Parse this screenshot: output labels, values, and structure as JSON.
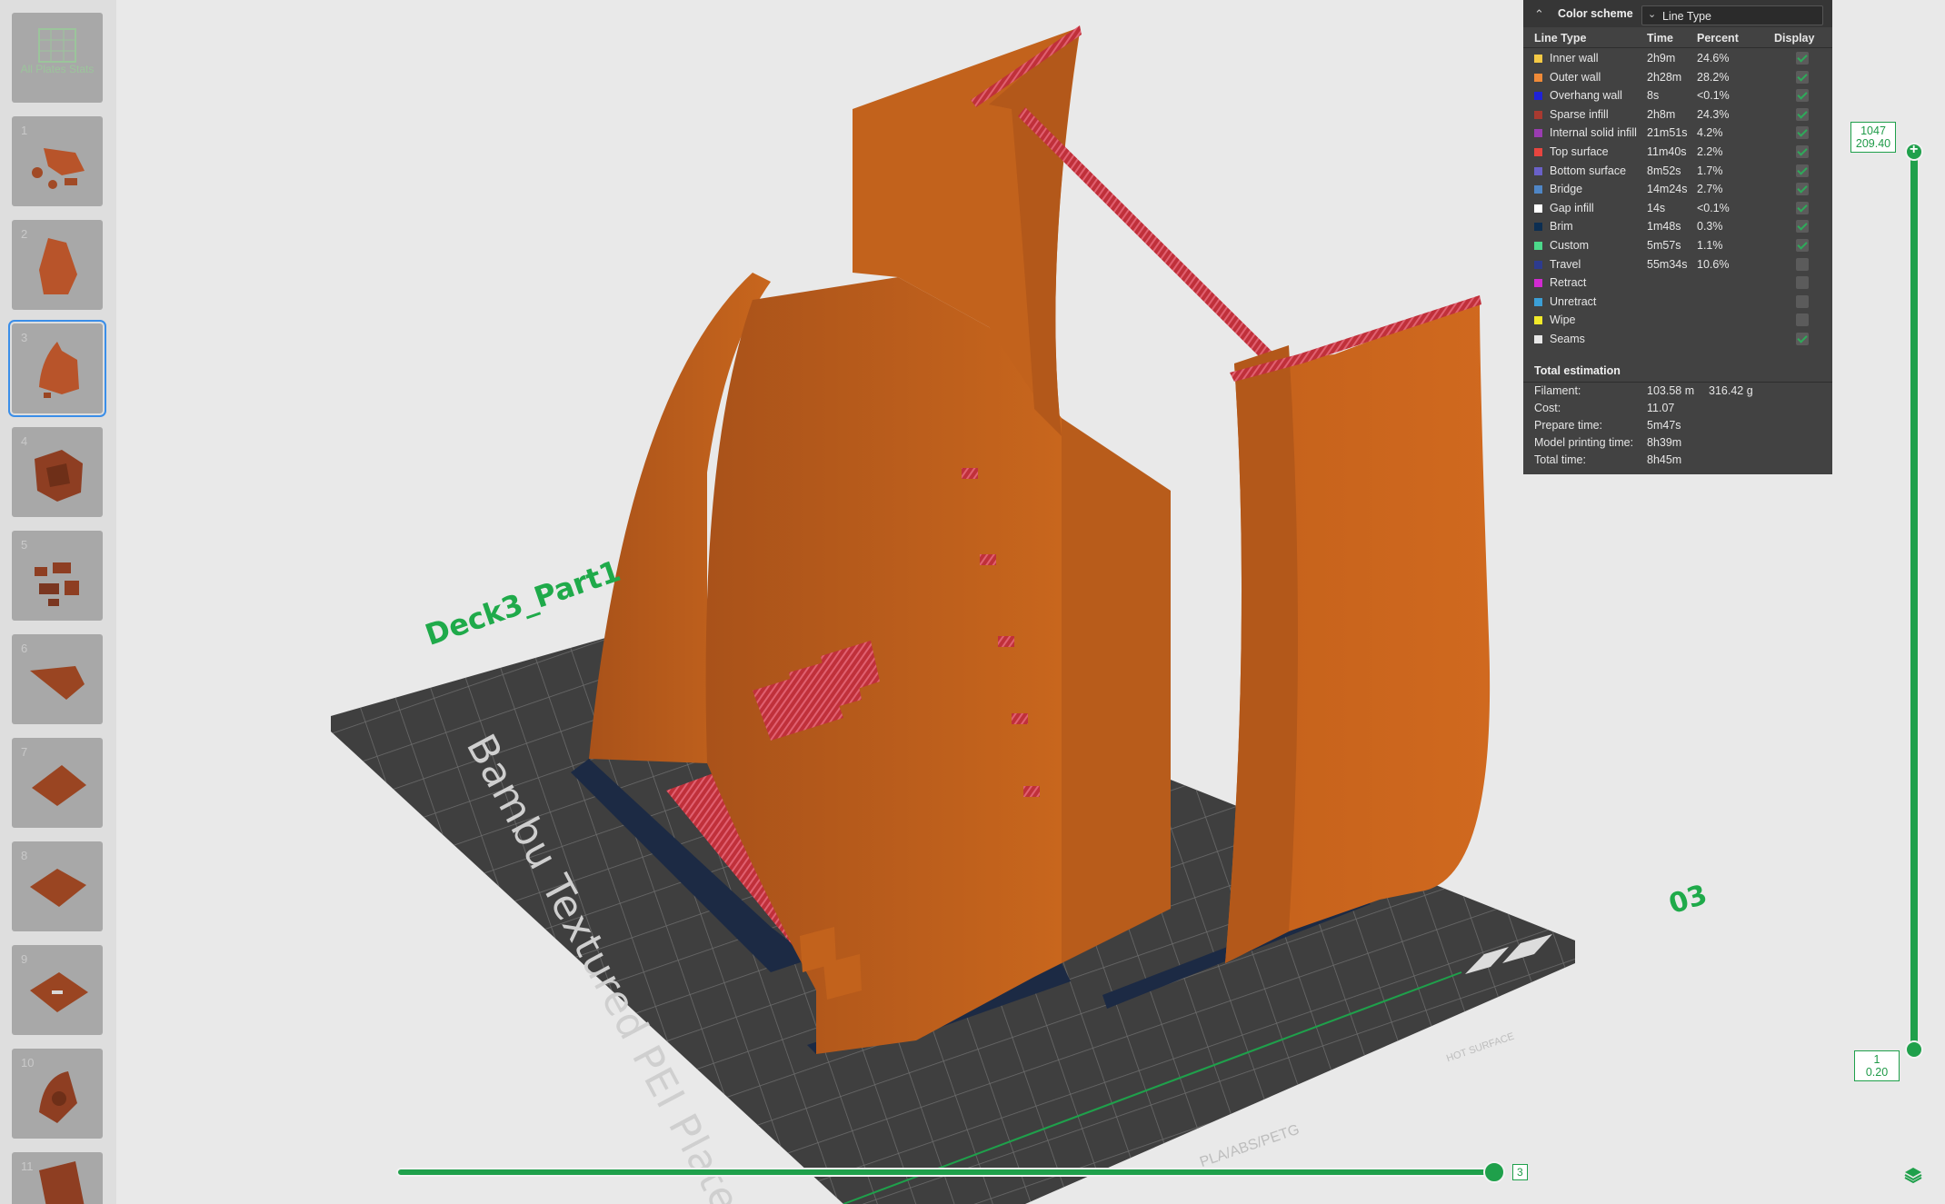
{
  "plates": {
    "all_label": "All Plates Stats",
    "items": [
      {
        "number": "1"
      },
      {
        "number": "2"
      },
      {
        "number": "3",
        "active": true
      },
      {
        "number": "4"
      },
      {
        "number": "5"
      },
      {
        "number": "6"
      },
      {
        "number": "7"
      },
      {
        "number": "8"
      },
      {
        "number": "9"
      },
      {
        "number": "10"
      },
      {
        "number": "11"
      }
    ]
  },
  "scene": {
    "plate_name": "Deck3_Part1",
    "plate_number": "03",
    "bed_label": "Bambu Textured PEI Plate",
    "bed_strip_label": "PLA/ABS/PETG",
    "bed_hot_label": "HOT SURFACE",
    "model_color": "#c1621a",
    "highlight_color": "#c0303a",
    "brim_color": "#1c2a44"
  },
  "legend": {
    "collapse_icon": "chevron-up-icon",
    "color_scheme_label": "Color scheme",
    "color_scheme_value": "Line Type",
    "columns": {
      "type": "Line Type",
      "time": "Time",
      "percent": "Percent",
      "display": "Display"
    },
    "rows": [
      {
        "name": "Inner wall",
        "time": "2h9m",
        "percent": "24.6%",
        "color": "#f5c945",
        "display": true
      },
      {
        "name": "Outer wall",
        "time": "2h28m",
        "percent": "28.2%",
        "color": "#ef8a38",
        "display": true
      },
      {
        "name": "Overhang wall",
        "time": "8s",
        "percent": "<0.1%",
        "color": "#1f22d8",
        "display": true
      },
      {
        "name": "Sparse infill",
        "time": "2h8m",
        "percent": "24.3%",
        "color": "#a83a30",
        "display": true
      },
      {
        "name": "Internal solid infill",
        "time": "21m51s",
        "percent": "4.2%",
        "color": "#9a3cb2",
        "display": true
      },
      {
        "name": "Top surface",
        "time": "11m40s",
        "percent": "2.2%",
        "color": "#e8453f",
        "display": true
      },
      {
        "name": "Bottom surface",
        "time": "8m52s",
        "percent": "1.7%",
        "color": "#6a61c9",
        "display": true
      },
      {
        "name": "Bridge",
        "time": "14m24s",
        "percent": "2.7%",
        "color": "#4f86c6",
        "display": true
      },
      {
        "name": "Gap infill",
        "time": "14s",
        "percent": "<0.1%",
        "color": "#ffffff",
        "display": true
      },
      {
        "name": "Brim",
        "time": "1m48s",
        "percent": "0.3%",
        "color": "#0c2e52",
        "display": true
      },
      {
        "name": "Custom",
        "time": "5m57s",
        "percent": "1.1%",
        "color": "#4cd88a",
        "display": true
      },
      {
        "name": "Travel",
        "time": "55m34s",
        "percent": "10.6%",
        "color": "#2d3b8e",
        "display": false
      },
      {
        "name": "Retract",
        "time": "",
        "percent": "",
        "color": "#d12ad1",
        "display": false
      },
      {
        "name": "Unretract",
        "time": "",
        "percent": "",
        "color": "#3b9fd6",
        "display": false
      },
      {
        "name": "Wipe",
        "time": "",
        "percent": "",
        "color": "#f2ea2a",
        "display": false
      },
      {
        "name": "Seams",
        "time": "",
        "percent": "",
        "color": "#e8e8e8",
        "display": true
      }
    ],
    "total_title": "Total estimation",
    "estimates": {
      "filament_label": "Filament:",
      "filament_length": "103.58 m",
      "filament_weight": "316.42 g",
      "cost_label": "Cost:",
      "cost_value": "11.07",
      "prepare_label": "Prepare time:",
      "prepare_value": "5m47s",
      "model_label": "Model printing time:",
      "model_value": "8h39m",
      "total_label": "Total time:",
      "total_value": "8h45m"
    }
  },
  "layer_slider": {
    "top_layer": "1047",
    "top_height": "209.40",
    "bottom_layer": "1",
    "bottom_height": "0.20"
  },
  "move_slider": {
    "value": "3"
  },
  "colors": {
    "accent": "#1fa04b",
    "panel": "#424242"
  }
}
